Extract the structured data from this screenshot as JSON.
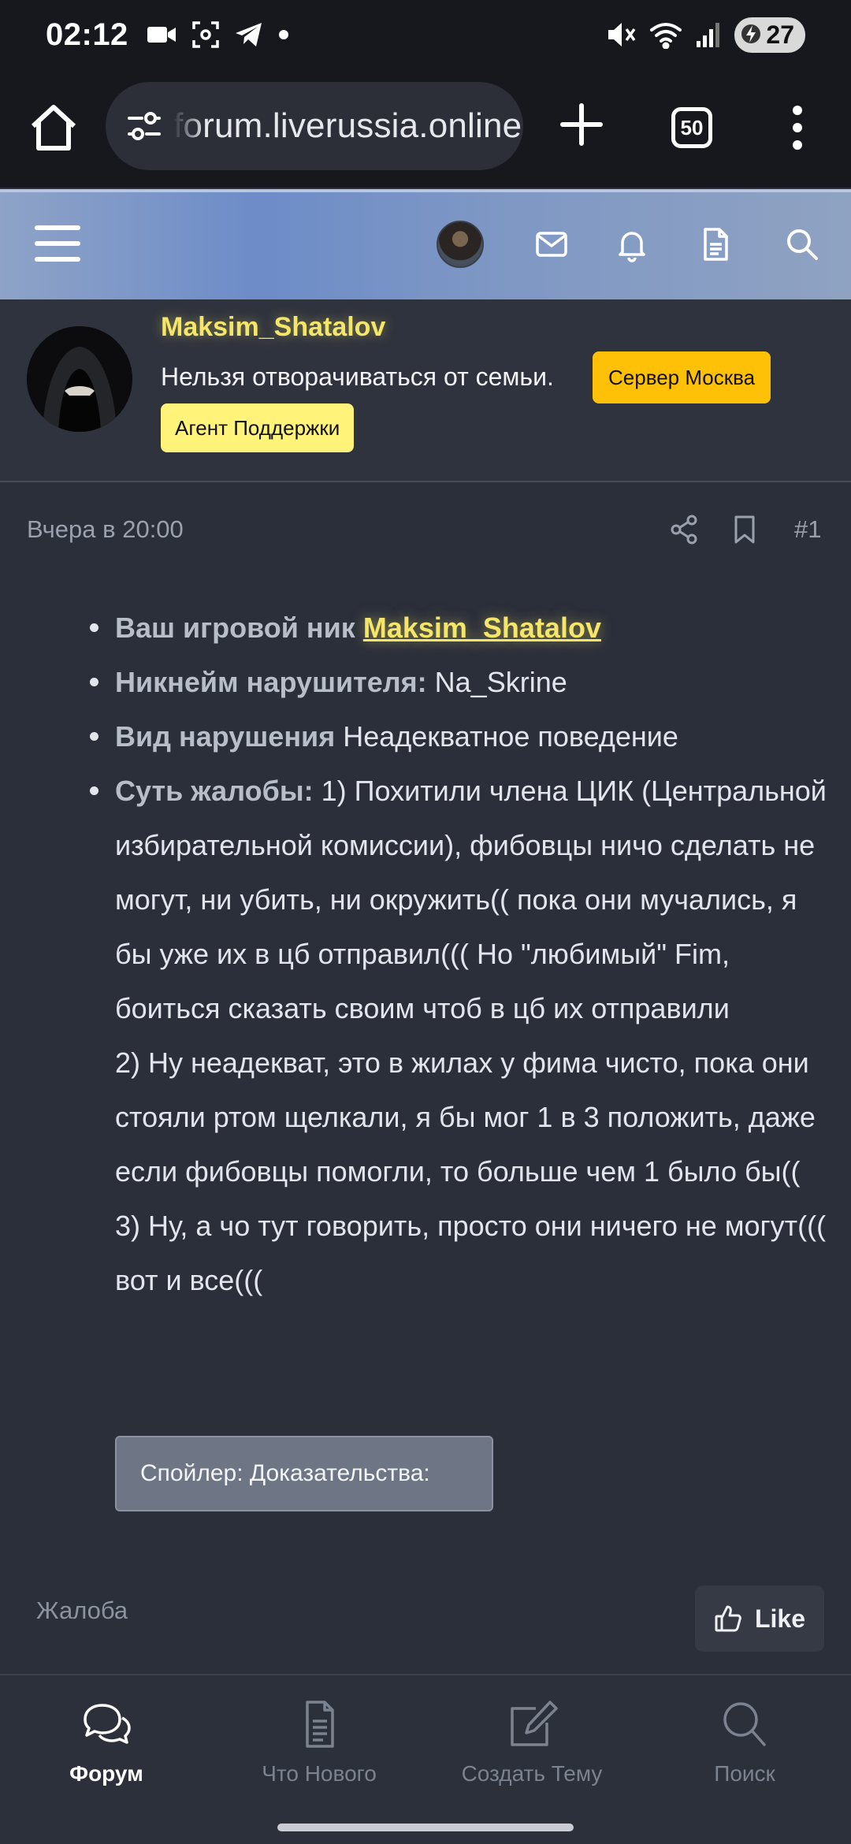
{
  "status_bar": {
    "time": "02:12",
    "battery": "27",
    "icons": [
      "video-call-icon",
      "screenshot-icon",
      "telegram-icon",
      "dot-icon",
      "mute-icon",
      "wifi-icon",
      "signal-icon",
      "battery-icon"
    ]
  },
  "browser": {
    "url": "forum.liverussia.online",
    "tab_count": "50"
  },
  "user": {
    "name": "Maksim_Shatalov",
    "title": "Нельзя отворачиваться от семьи.",
    "badge_server": "Сервер Москва",
    "badge_agent": "Агент Поддержки"
  },
  "post": {
    "date": "Вчера в 20:00",
    "number": "#1",
    "items": [
      {
        "label": "Ваш игровой ник",
        "link": "Maksim_Shatalov"
      },
      {
        "label": "Никнейм нарушителя:",
        "value": "Na_Skrine"
      },
      {
        "label": "Вид нарушения",
        "value": "Неадекватное поведение"
      },
      {
        "label": "Суть жалобы:",
        "lines": [
          "1) Похитили члена ЦИК (Центральной избирательной комиссии), фибовцы ничо сделать не могут, ни убить, ни окружить(( пока они мучались, я бы уже их в цб отправил((( Но \"любимый\" Fim, боиться сказать своим чтоб в цб их отправили",
          "2) Ну неадекват, это в жилах у фима чисто, пока они стояли ртом щелкали, я бы мог 1 в 3 положить, даже если фибовцы помогли, то больше чем 1 было бы((",
          "3) Ну, а чо тут говорить, просто они ничего не могут((( вот и все((("
        ]
      }
    ],
    "spoiler": "Спойлер: Доказательства:",
    "tag": "Жалоба",
    "like": "Like"
  },
  "nav": [
    {
      "label": "Форум",
      "icon": "forum-icon",
      "active": true
    },
    {
      "label": "Что Нового",
      "icon": "document-icon",
      "active": false
    },
    {
      "label": "Создать Тему",
      "icon": "edit-icon",
      "active": false
    },
    {
      "label": "Поиск",
      "icon": "search-icon",
      "active": false
    }
  ]
}
